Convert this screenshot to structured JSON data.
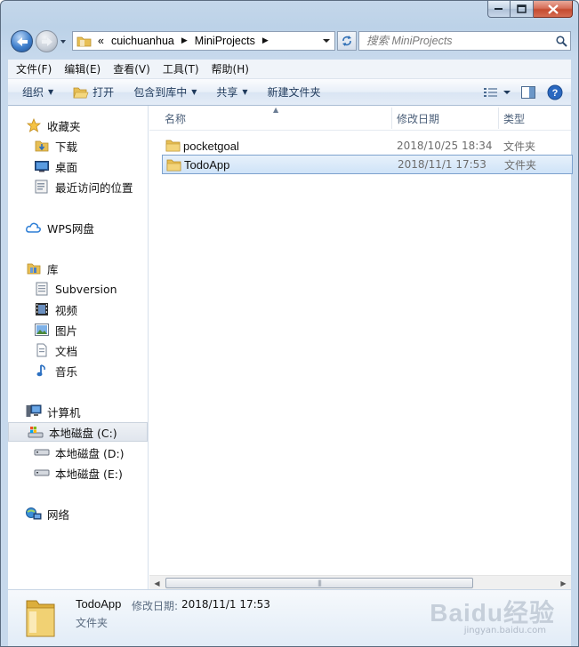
{
  "window": {
    "caption": {
      "minimize_icon": "minimize-icon",
      "maximize_icon": "maximize-icon",
      "close_icon": "close-icon"
    }
  },
  "nav": {
    "back_icon": "back-arrow-icon",
    "forward_icon": "forward-arrow-icon",
    "address": {
      "prefix": "«",
      "segments": [
        "cuichuanhua",
        "MiniProjects"
      ]
    },
    "search_placeholder": "搜索 MiniProjects"
  },
  "menubar": {
    "items": [
      "文件(F)",
      "编辑(E)",
      "查看(V)",
      "工具(T)",
      "帮助(H)"
    ]
  },
  "toolbar": {
    "organize": "组织",
    "open": "打开",
    "include_in_library": "包含到库中",
    "share": "共享",
    "new_folder": "新建文件夹"
  },
  "sidebar": {
    "favorites": {
      "label": "收藏夹",
      "items": [
        "下载",
        "桌面",
        "最近访问的位置"
      ]
    },
    "wps": {
      "label": "WPS网盘"
    },
    "libraries": {
      "label": "库",
      "items": [
        "Subversion",
        "视频",
        "图片",
        "文档",
        "音乐"
      ]
    },
    "computer": {
      "label": "计算机",
      "items": [
        "本地磁盘 (C:)",
        "本地磁盘 (D:)",
        "本地磁盘 (E:)"
      ],
      "selected": "本地磁盘 (C:)"
    },
    "network": {
      "label": "网络"
    }
  },
  "files": {
    "columns": {
      "name": "名称",
      "modified": "修改日期",
      "type": "类型"
    },
    "rows": [
      {
        "name": "pocketgoal",
        "modified": "2018/10/25 18:34",
        "type": "文件夹",
        "selected": false
      },
      {
        "name": "TodoApp",
        "modified": "2018/11/1 17:53",
        "type": "文件夹",
        "selected": true
      }
    ]
  },
  "details": {
    "name": "TodoApp",
    "modified_label": "修改日期:",
    "modified_value": "2018/11/1 17:53",
    "type": "文件夹"
  },
  "watermark": {
    "text": "Baidu经验",
    "sub": "jingyan.baidu.com"
  },
  "colors": {
    "selection_border": "#7da2ce",
    "selection_fill": "#cfe3f8",
    "folder": "#e8c25a"
  }
}
